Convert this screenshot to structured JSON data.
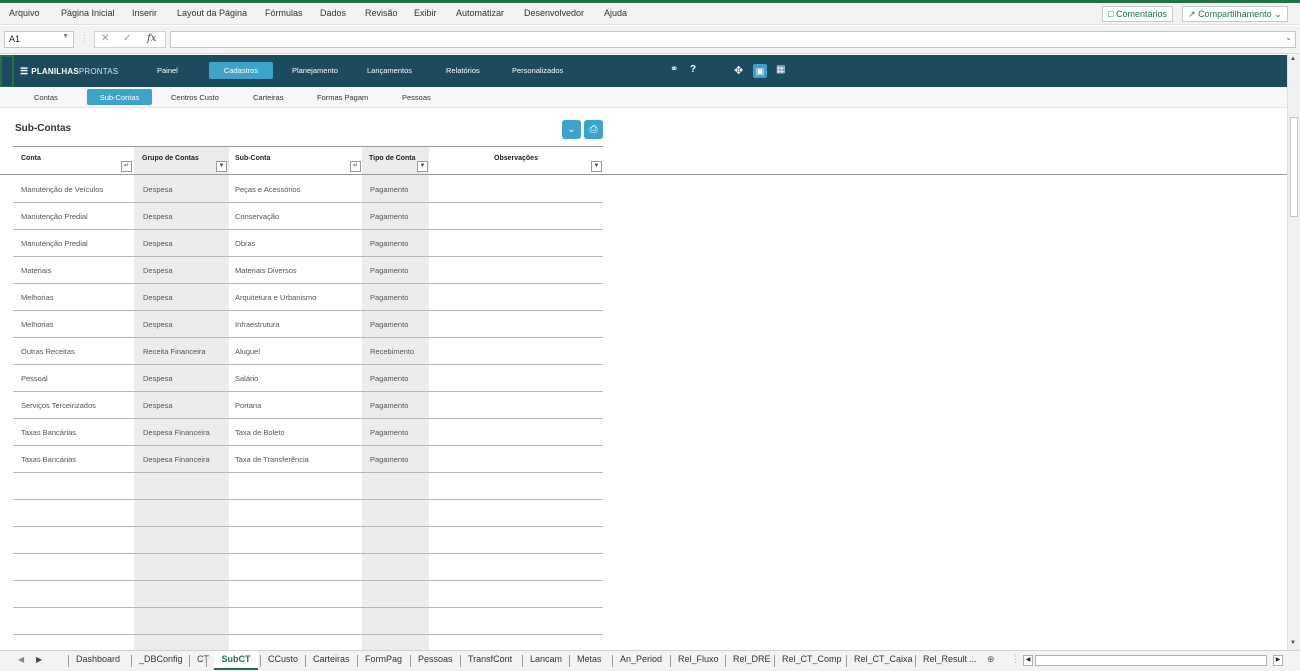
{
  "menu": {
    "items": [
      "Arquivo",
      "Página Inicial",
      "Inserir",
      "Layout da Página",
      "Fórmulas",
      "Dados",
      "Revisão",
      "Exibir",
      "Automatizar",
      "Desenvolvedor",
      "Ajuda"
    ],
    "comments_label": "Comentários",
    "share_label": "Compartilhamento"
  },
  "formula_bar": {
    "name_box": "A1",
    "formula": ""
  },
  "app": {
    "logo_bold": "PLANILHAS",
    "logo_light": "PRONTAS",
    "nav": [
      "Painel",
      "Cadastros",
      "Planejamento",
      "Lançamentos",
      "Relatórios",
      "Personalizados"
    ],
    "active_nav": "Cadastros",
    "subnav": [
      "Contas",
      "Sub-Contas",
      "Centros Custo",
      "Carteiras",
      "Formas Pagam",
      "Pessoas"
    ],
    "active_subnav": "Sub-Contas"
  },
  "page_title": "Sub-Contas",
  "table": {
    "headers": [
      "Conta",
      "Grupo de Contas",
      "Sub-Conta",
      "Tipo de Conta",
      "Observações"
    ],
    "rows": [
      [
        "Manutenção de Veículos",
        "Despesa",
        "Peças e Acessórios",
        "Pagamento",
        ""
      ],
      [
        "Manutenção Predial",
        "Despesa",
        "Conservação",
        "Pagamento",
        ""
      ],
      [
        "Manutenção Predial",
        "Despesa",
        "Obras",
        "Pagamento",
        ""
      ],
      [
        "Materiais",
        "Despesa",
        "Materiais Diversos",
        "Pagamento",
        ""
      ],
      [
        "Melhorias",
        "Despesa",
        "Arquitetura e Urbanismo",
        "Pagamento",
        ""
      ],
      [
        "Melhorias",
        "Despesa",
        "Infraestrutura",
        "Pagamento",
        ""
      ],
      [
        "Outras Receitas",
        "Receita Financeira",
        "Aluguel",
        "Recebimento",
        ""
      ],
      [
        "Pessoal",
        "Despesa",
        "Salário",
        "Pagamento",
        ""
      ],
      [
        "Serviços Terceirizados",
        "Despesa",
        "Portaria",
        "Pagamento",
        ""
      ],
      [
        "Taxas Bancárias",
        "Despesa Financeira",
        "Taxa de Boleto",
        "Pagamento",
        ""
      ],
      [
        "Taxas Bancárias",
        "Despesa Financeira",
        "Taxa de Transferência",
        "Pagamento",
        ""
      ]
    ],
    "empty_rows": 6
  },
  "sheet_tabs": [
    "Dashboard",
    "_DBConfig",
    "CT",
    "SubCT",
    "CCusto",
    "Carteiras",
    "FormPag",
    "Pessoas",
    "TransfCont",
    "Lancam",
    "Metas",
    "An_Period",
    "Rel_Fluxo",
    "Rel_DRE",
    "Rel_CT_Comp",
    "Rel_CT_Caixa",
    "Rel_Result"
  ],
  "active_tab": "SubCT",
  "more_tabs": "...",
  "icons": [
    "comment-icon",
    "share-icon",
    "menu-icon",
    "link-icon",
    "help-icon",
    "move-icon",
    "lock-icon",
    "grid-icon",
    "expand-icon",
    "print-icon",
    "filter-icon",
    "add-sheet-icon"
  ],
  "colors": {
    "excel_green": "#217346",
    "app_header": "#1c4b5e",
    "accent": "#3da3c9"
  }
}
